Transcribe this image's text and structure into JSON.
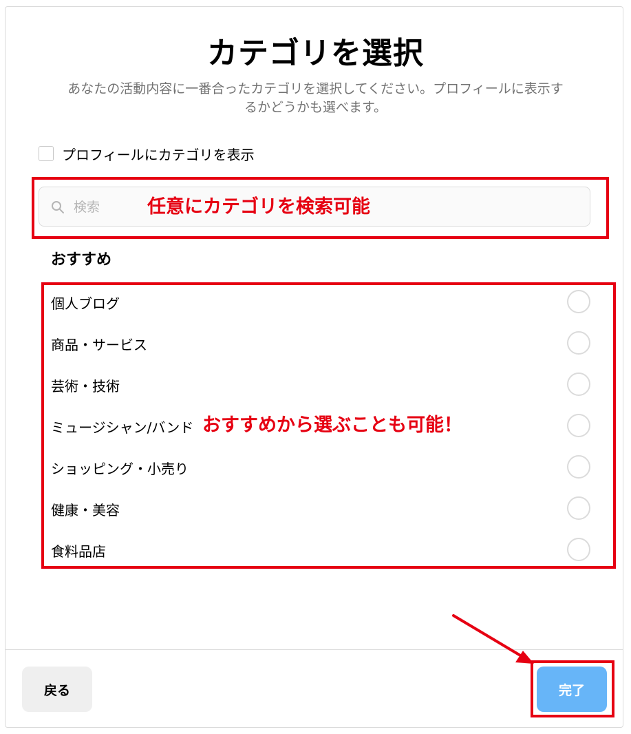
{
  "dialog": {
    "title": "カテゴリを選択",
    "subtitle_line1": "あなたの活動内容に一番合ったカテゴリを選択してください。プロフィールに表示す",
    "subtitle_line2": "るかどうかも選べます。"
  },
  "display_toggle": {
    "label": "プロフィールにカテゴリを表示",
    "checked": false
  },
  "search": {
    "placeholder": "検索",
    "icon": "search-icon"
  },
  "recommended": {
    "title": "おすすめ",
    "items": [
      {
        "label": "個人ブログ"
      },
      {
        "label": "商品・サービス"
      },
      {
        "label": "芸術・技術"
      },
      {
        "label": "ミュージシャン/バンド"
      },
      {
        "label": "ショッピング・小売り"
      },
      {
        "label": "健康・美容"
      },
      {
        "label": "食料品店"
      }
    ]
  },
  "footer": {
    "back_label": "戻る",
    "done_label": "完了"
  },
  "annotations": {
    "search_note": "任意にカテゴリを検索可能",
    "list_note": "おすすめから選ぶことも可能！"
  },
  "colors": {
    "annotation_red": "#e60012",
    "done_button_blue": "#67b5f8",
    "back_button_gray": "#efefef",
    "border_gray": "#dbdbdb",
    "subtitle_gray": "#737373"
  }
}
